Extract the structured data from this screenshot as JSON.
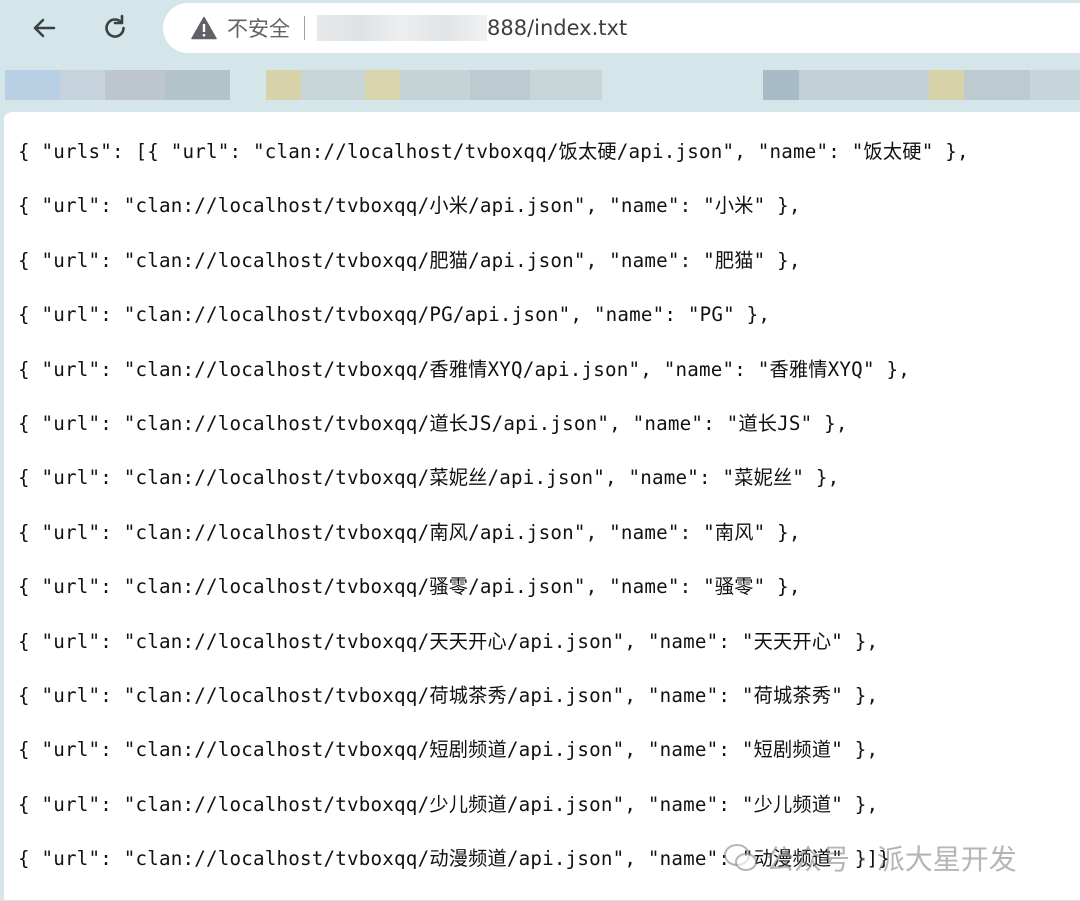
{
  "toolbar": {
    "security_label": "不安全",
    "url_suffix": "888/index.txt"
  },
  "content": {
    "lines": [
      "{ \"urls\": [{ \"url\": \"clan://localhost/tvboxqq/饭太硬/api.json\", \"name\": \"饭太硬\" },",
      "{ \"url\": \"clan://localhost/tvboxqq/小米/api.json\", \"name\": \"小米\" },",
      "{ \"url\": \"clan://localhost/tvboxqq/肥猫/api.json\", \"name\": \"肥猫\" },",
      "{ \"url\": \"clan://localhost/tvboxqq/PG/api.json\", \"name\": \"PG\" },",
      "{ \"url\": \"clan://localhost/tvboxqq/香雅情XYQ/api.json\", \"name\": \"香雅情XYQ\" },",
      "{ \"url\": \"clan://localhost/tvboxqq/道长JS/api.json\", \"name\": \"道长JS\" },",
      "{ \"url\": \"clan://localhost/tvboxqq/菜妮丝/api.json\", \"name\": \"菜妮丝\" },",
      "{ \"url\": \"clan://localhost/tvboxqq/南风/api.json\", \"name\": \"南风\" },",
      "{ \"url\": \"clan://localhost/tvboxqq/骚零/api.json\", \"name\": \"骚零\" },",
      "{ \"url\": \"clan://localhost/tvboxqq/天天开心/api.json\", \"name\": \"天天开心\" },",
      "{ \"url\": \"clan://localhost/tvboxqq/荷城茶秀/api.json\", \"name\": \"荷城茶秀\" },",
      "{ \"url\": \"clan://localhost/tvboxqq/短剧频道/api.json\", \"name\": \"短剧频道\" },",
      "{ \"url\": \"clan://localhost/tvboxqq/少儿频道/api.json\", \"name\": \"少儿频道\" },",
      "{ \"url\": \"clan://localhost/tvboxqq/动漫频道/api.json\", \"name\": \"动漫频道\" }]}"
    ]
  },
  "watermark": {
    "text": "公众号 · 派大星开发"
  }
}
